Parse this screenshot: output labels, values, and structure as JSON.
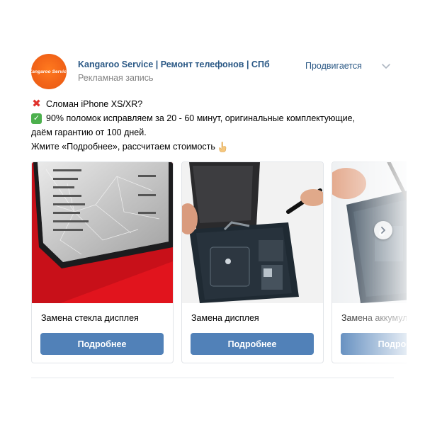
{
  "post": {
    "author": "Kangaroo Service | Ремонт телефонов | СПб",
    "subtitle": "Рекламная запись",
    "promo_label": "Продвигается",
    "avatar_logo_text": "Kangaroo Service",
    "text": {
      "line1": "Сломан iPhone XS/XR?",
      "line2": "90% поломок исправляем за 20 - 60 минут, оригинальные комплектующие,",
      "line3": "даём гарантию от 100 дней.",
      "line4": "Жмите «Подробнее», рассчитаем стоимость"
    },
    "icons": {
      "avatar": "kangaroo-logo",
      "menu": "chevron-down-icon",
      "emoji1": "cross-mark-icon",
      "emoji2": "check-mark-icon",
      "emoji3": "pointing-hand-icon",
      "carousel_next": "chevron-right-icon"
    },
    "cards": [
      {
        "title": "Замена стекла дисплея",
        "button": "Подробнее",
        "image": "cracked-phone-screen"
      },
      {
        "title": "Замена дисплея",
        "button": "Подробнее",
        "image": "iphone-opened-repair"
      },
      {
        "title": "Замена аккумулятора",
        "button": "Подробнее",
        "image": "iphone-battery-repair"
      }
    ]
  },
  "colors": {
    "link": "#2a5885",
    "button": "#5181b8",
    "muted": "#828282",
    "avatar": "#f26418"
  }
}
